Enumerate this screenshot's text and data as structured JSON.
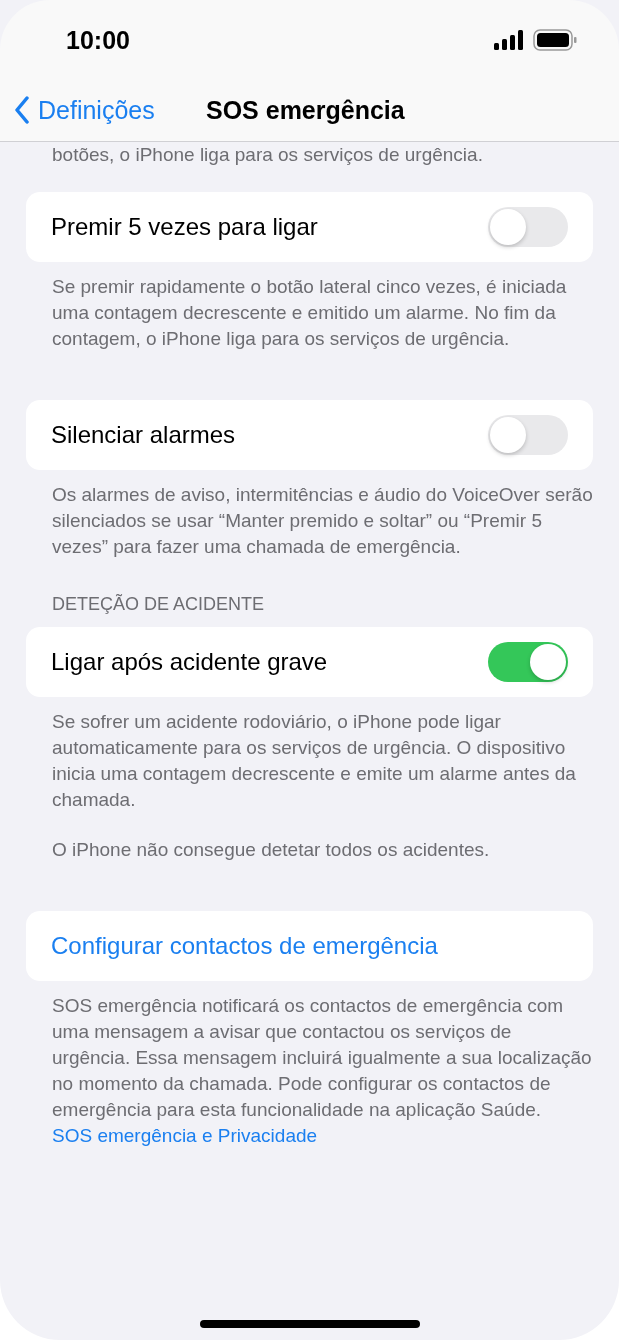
{
  "status_bar": {
    "time": "10:00"
  },
  "nav": {
    "back": "Definições",
    "title": "SOS emergência"
  },
  "top_footer": "botões, o iPhone liga para os serviços de urgência.",
  "sections": [
    {
      "rows": [
        {
          "kind": "toggle",
          "label": "Premir 5 vezes para ligar",
          "on": false
        }
      ],
      "footer": [
        "Se premir rapidamente o botão lateral cinco vezes, é iniciada uma contagem decrescente e emitido um alarme. No fim da contagem, o iPhone liga para os serviços de urgência."
      ]
    },
    {
      "rows": [
        {
          "kind": "toggle",
          "label": "Silenciar alarmes",
          "on": false
        }
      ],
      "footer": [
        "Os alarmes de aviso, intermitências e áudio do VoiceOver serão silenciados se usar “Manter premido e soltar” ou “Premir 5 vezes” para fazer uma chamada de emergência."
      ]
    },
    {
      "header": "DETEÇÃO DE ACIDENTE",
      "rows": [
        {
          "kind": "toggle",
          "label": "Ligar após acidente grave",
          "on": true
        }
      ],
      "footer": [
        "Se sofrer um acidente rodoviário, o iPhone pode ligar automaticamente para os serviços de urgência. O dispositivo inicia uma contagem decrescente e emite um alarme antes da chamada.",
        "O iPhone não consegue detetar todos os acidentes."
      ]
    },
    {
      "rows": [
        {
          "kind": "link",
          "label": "Configurar contactos de emergência"
        }
      ],
      "footer": [
        "SOS emergência notificará os contactos de emergência com uma mensagem a avisar que contactou os serviços de urgência. Essa mensagem incluirá igualmente a sua localização no momento da chamada. Pode configurar os contactos de emergência para esta funcionalidade na aplicação Saúde."
      ],
      "footer_link": "SOS emergência e Privacidade"
    }
  ]
}
